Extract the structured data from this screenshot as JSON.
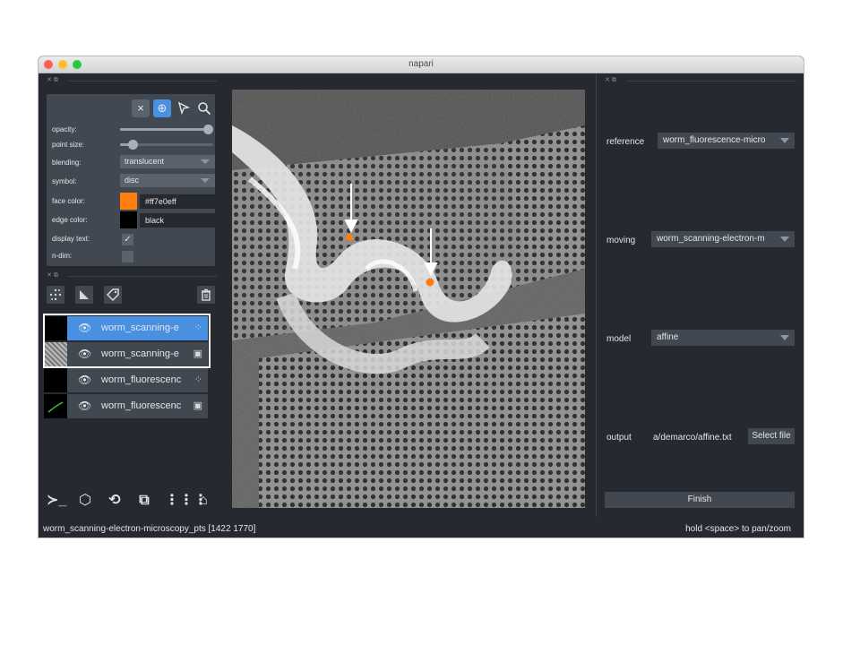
{
  "window": {
    "title": "napari"
  },
  "layer_controls": {
    "tools": [
      "×",
      "⊕",
      "⇱",
      "⌕"
    ],
    "opacity_label": "opacity:",
    "opacity_value": 1.0,
    "point_size_label": "point size:",
    "point_size_value": 0.1,
    "blending_label": "blending:",
    "blending_value": "translucent",
    "symbol_label": "symbol:",
    "symbol_value": "disc",
    "face_color_label": "face color:",
    "face_color_value": "#ff7e0eff",
    "face_color_hex": "#ff7e0e",
    "edge_color_label": "edge color:",
    "edge_color_value": "black",
    "edge_color_hex": "#000000",
    "display_text_label": "display text:",
    "display_text_checked": "✓",
    "ndim_label": "n-dim:"
  },
  "layer_buttons": {
    "new_points": "points-icon",
    "new_shapes": "shapes-icon",
    "new_labels": "labels-icon",
    "delete": "trash-icon"
  },
  "layers": [
    {
      "name": "worm_scanning-e",
      "type": "points",
      "selected": true
    },
    {
      "name": "worm_scanning-e",
      "type": "image",
      "selected": false
    },
    {
      "name": "worm_fluorescenc",
      "type": "points",
      "selected": false
    },
    {
      "name": "worm_fluorescenc",
      "type": "image",
      "selected": false
    }
  ],
  "bottom_buttons": [
    "console-icon",
    "ndisplay-icon",
    "roll-icon",
    "transpose-icon",
    "grid-icon",
    "home-icon"
  ],
  "right_panel": {
    "reference_label": "reference",
    "reference_value": "worm_fluorescence-micro",
    "moving_label": "moving",
    "moving_value": "worm_scanning-electron-m",
    "model_label": "model",
    "model_value": "affine",
    "output_label": "output",
    "output_value": "a/demarco/affine.txt",
    "select_file": "Select file",
    "finish": "Finish"
  },
  "status": {
    "left": "worm_scanning-electron-microscopy_pts [1422 1770]",
    "right": "hold <space> to pan/zoom"
  },
  "colors": {
    "accent": "#4a90e2",
    "point": "#ff7e0e"
  }
}
